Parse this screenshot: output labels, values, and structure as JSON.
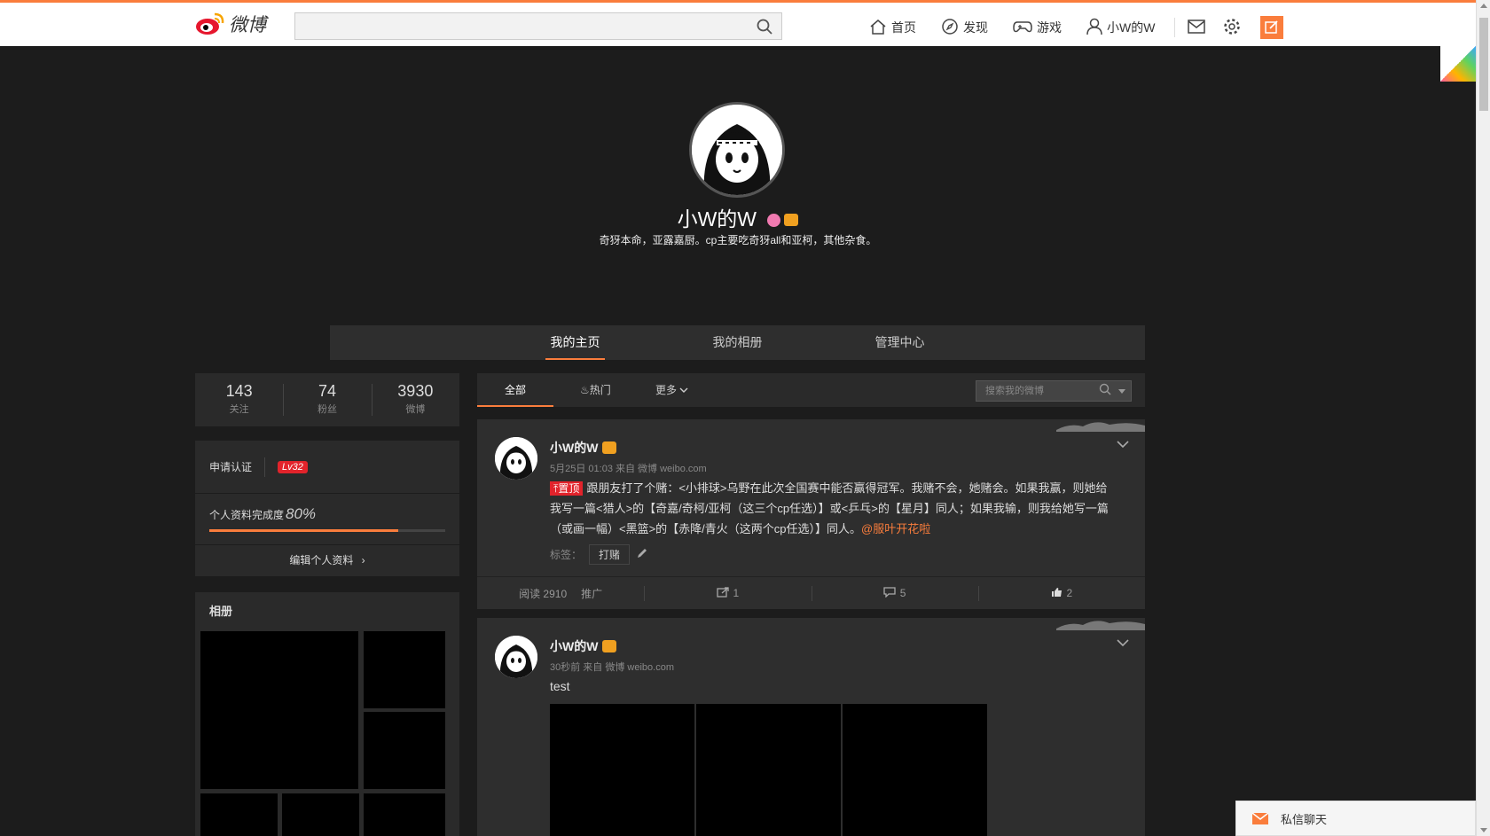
{
  "header": {
    "logo_text": "微博",
    "search_placeholder": "",
    "nav": [
      {
        "icon": "home-icon",
        "label": "首页"
      },
      {
        "icon": "compass-icon",
        "label": "发现"
      },
      {
        "icon": "gamepad-icon",
        "label": "游戏"
      },
      {
        "icon": "user-icon",
        "label": "小W的W"
      }
    ],
    "accent": "#fa7d3c"
  },
  "profile": {
    "name": "小W的W",
    "description": "奇犽本命，亚露嘉厨。cp主要吃奇犽all和亚柯，其他杂食。"
  },
  "tabs": [
    "我的主页",
    "我的相册",
    "管理中心"
  ],
  "counts": [
    {
      "value": "143",
      "label": "关注"
    },
    {
      "value": "74",
      "label": "粉丝"
    },
    {
      "value": "3930",
      "label": "微博"
    }
  ],
  "info": {
    "verify": "申请认证",
    "level": "Lv32",
    "completion_label": "个人资料完成度",
    "completion_value": "80%",
    "completion_fraction": 0.8,
    "edit": "编辑个人资料"
  },
  "album": {
    "title": "相册"
  },
  "feed": {
    "tabs": [
      "全部",
      "热门",
      "更多"
    ],
    "search_placeholder": "搜索我的微博",
    "posts": [
      {
        "name": "小W的W",
        "meta": "5月25日 01:03 来自 微博 weibo.com",
        "pin": "置顶",
        "text": "跟朋友打了个赌：<小排球>乌野在此次全国赛中能否赢得冠军。我赌不会，她赌会。如果我赢，则她给我写一篇<猎人>的【奇嘉/奇柯/亚柯（这三个cp任选）】或<乒乓>的【星月】同人；如果我输，则我给她写一篇（或画一幅）<黑篮>的【赤降/青火（这两个cp任选）】同人。",
        "mention": "@服叶开花啦",
        "tags_label": "标签：",
        "tag": "打赌",
        "reads": "阅读 2910",
        "promote": "推广",
        "reposts": "1",
        "comments": "5",
        "likes": "2"
      },
      {
        "name": "小W的W",
        "meta": "30秒前 来自 微博 weibo.com",
        "text": "test"
      }
    ]
  },
  "chat": {
    "label": "私信聊天"
  }
}
